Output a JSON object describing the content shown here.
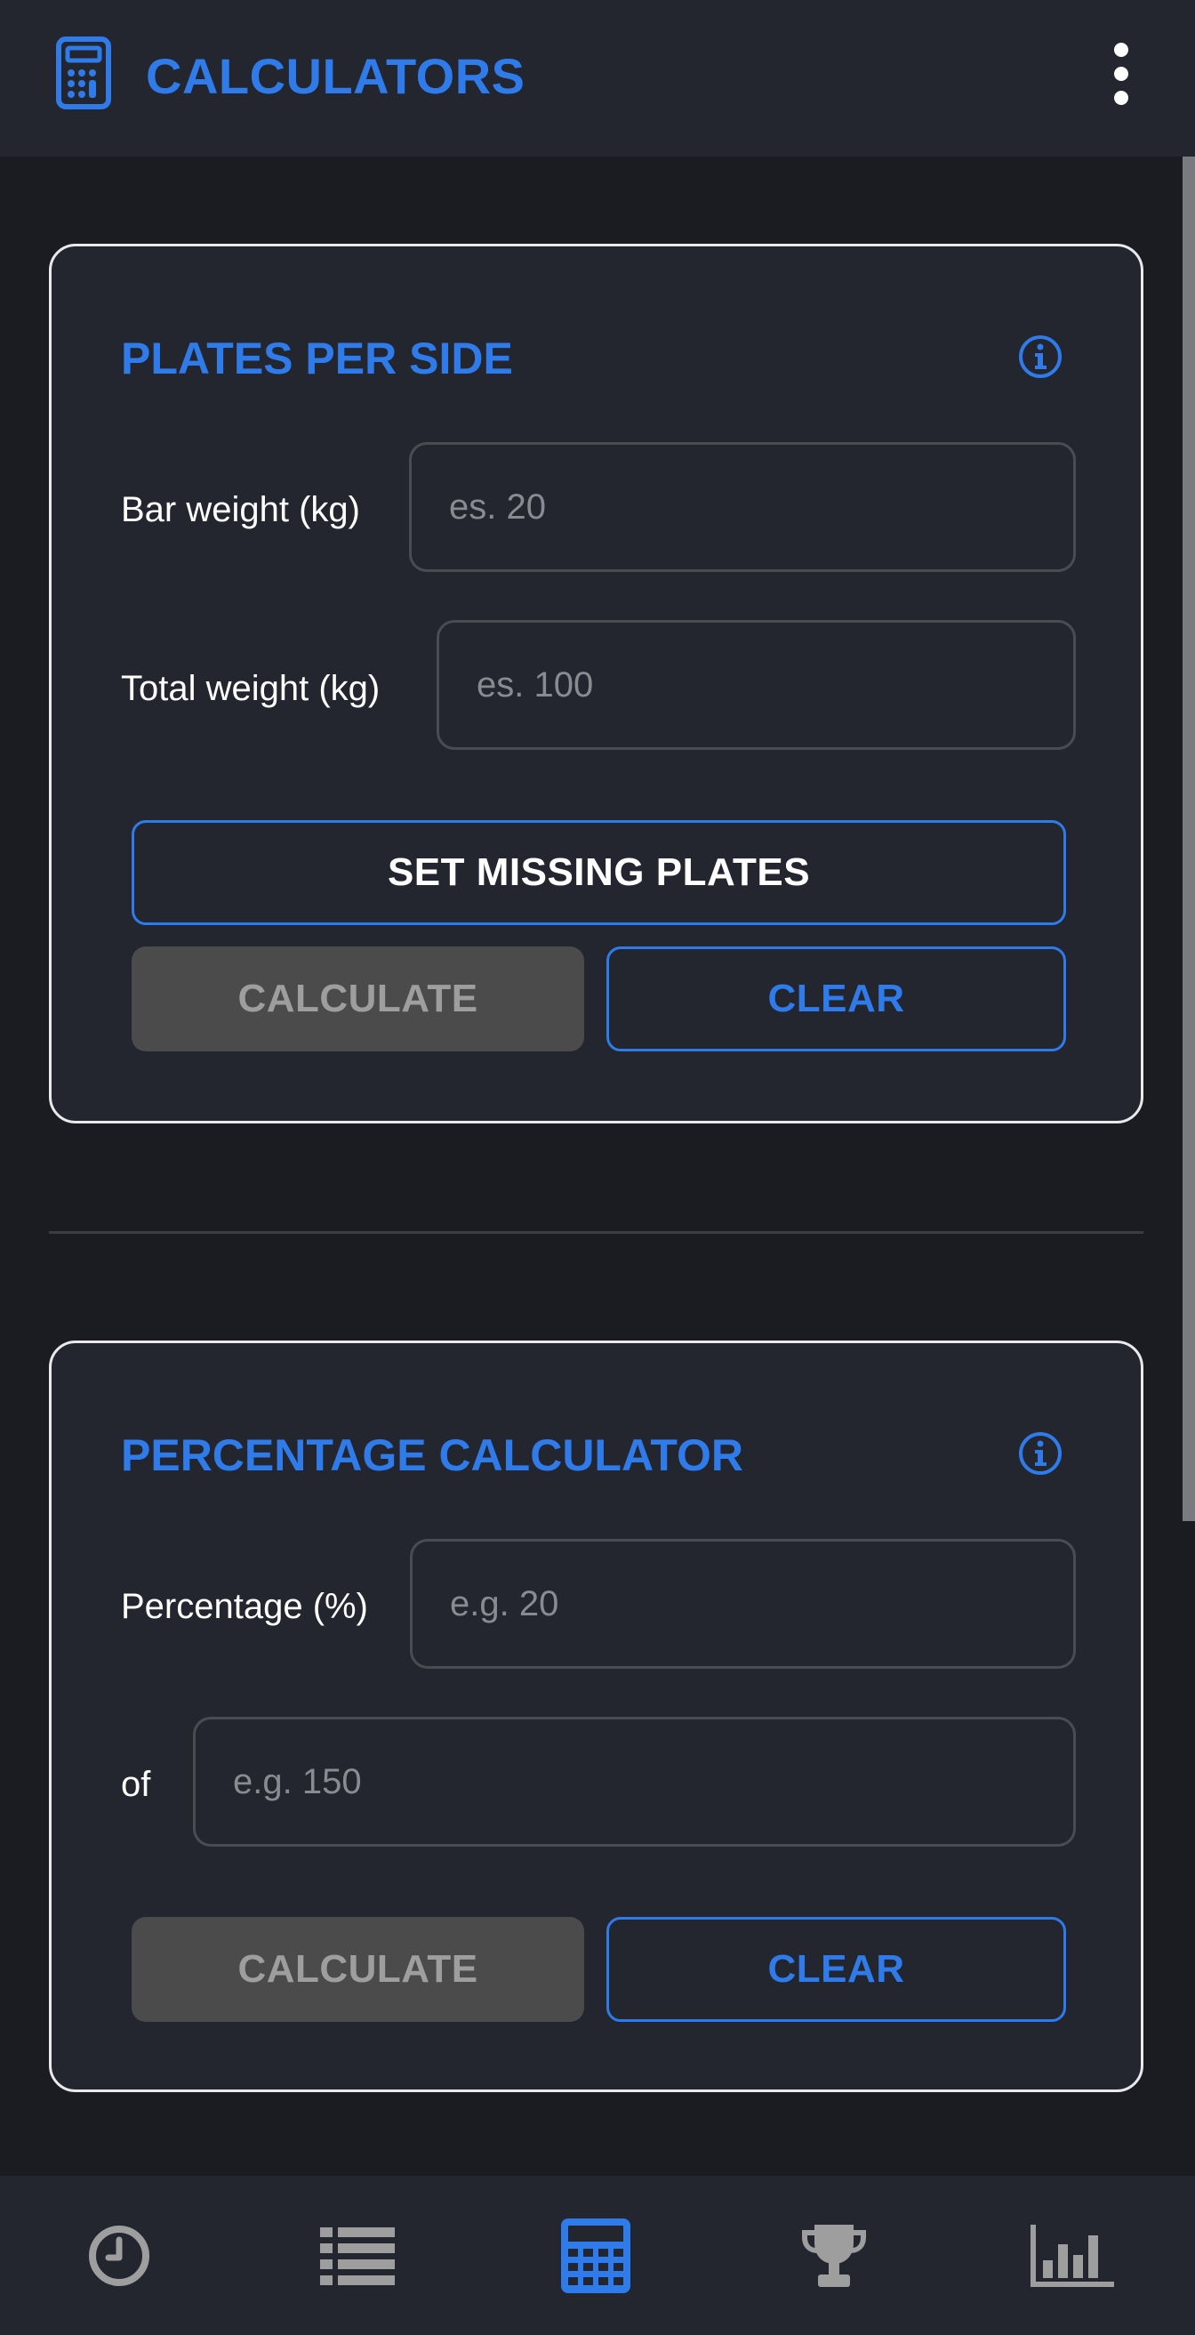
{
  "header": {
    "title": "CALCULATORS",
    "app_icon": "calculator-icon",
    "menu_icon": "more-vertical-icon"
  },
  "plates_card": {
    "title": "PLATES PER SIDE",
    "info_icon": "info-icon",
    "bar_weight_label": "Bar weight (kg)",
    "bar_weight_placeholder": "es. 20",
    "bar_weight_value": "",
    "total_weight_label": "Total weight (kg)",
    "total_weight_placeholder": "es. 100",
    "total_weight_value": "",
    "set_missing_plates_label": "SET MISSING PLATES",
    "calculate_label": "CALCULATE",
    "calculate_enabled": false,
    "clear_label": "CLEAR"
  },
  "percentage_card": {
    "title": "PERCENTAGE CALCULATOR",
    "info_icon": "info-icon",
    "percentage_label": "Percentage (%)",
    "percentage_placeholder": "e.g. 20",
    "percentage_value": "",
    "of_label": "of",
    "of_placeholder": "e.g. 150",
    "of_value": "",
    "calculate_label": "CALCULATE",
    "calculate_enabled": false,
    "clear_label": "CLEAR"
  },
  "bottom_nav": {
    "items": [
      {
        "icon": "clock-icon",
        "active": false
      },
      {
        "icon": "list-icon",
        "active": false
      },
      {
        "icon": "calculator-icon",
        "active": true
      },
      {
        "icon": "trophy-icon",
        "active": false
      },
      {
        "icon": "bar-chart-icon",
        "active": false
      }
    ]
  },
  "colors": {
    "accent": "#2f7bea",
    "background": "#1b1c21",
    "surface": "#23262f",
    "inactive_icon": "#9e9e9e",
    "disabled_button": "#4b4b4b"
  }
}
